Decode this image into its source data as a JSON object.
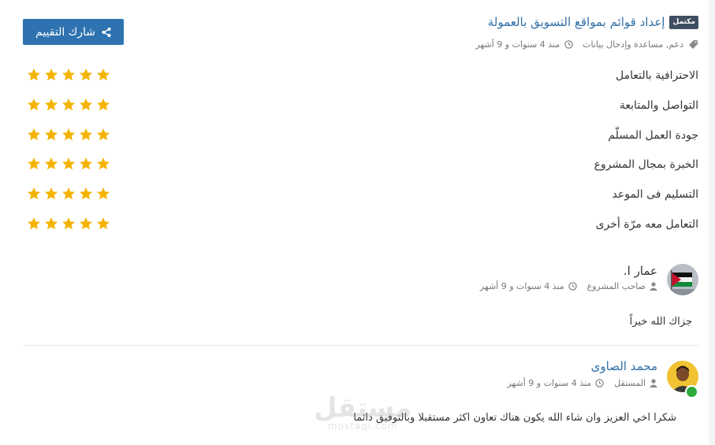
{
  "project": {
    "badge": "مكتمل",
    "title": "إعداد قوائم بمواقع التسويق بالعمولة",
    "tags": "دعم, مساعدة وإدخال بيانات",
    "time": "منذ 4 سنوات و 9 أشهر"
  },
  "share_button": {
    "label": "شارك التقييم"
  },
  "ratings": [
    {
      "label": "الاحترافية بالتعامل",
      "stars": 5
    },
    {
      "label": "التواصل والمتابعة",
      "stars": 5
    },
    {
      "label": "جودة العمل المسلّم",
      "stars": 5
    },
    {
      "label": "الخبرة بمجال المشروع",
      "stars": 5
    },
    {
      "label": "التسليم فى الموعد",
      "stars": 5
    },
    {
      "label": "التعامل معه مرّة أخرى",
      "stars": 5
    }
  ],
  "comments": [
    {
      "name": "عمار ا.",
      "role": "صاحب المشروع",
      "time": "منذ 4 سنوات و 9 أشهر",
      "text": "جزاك الله خيراً"
    },
    {
      "name": "محمد الصاوى",
      "role": "المستقل",
      "time": "منذ 4 سنوات و 9 أشهر",
      "text": "شكرا اخي العزيز وان شاء الله يكون هناك تعاون اكثر مستقبلا وبالتوفيق دائما"
    }
  ],
  "watermark": {
    "logo": "مستقل",
    "domain": "mostaqi.com"
  },
  "colors": {
    "accent": "#2e73b0",
    "star": "#f5b301",
    "badge": "#3f4e60",
    "verified": "#2eaa3c"
  }
}
